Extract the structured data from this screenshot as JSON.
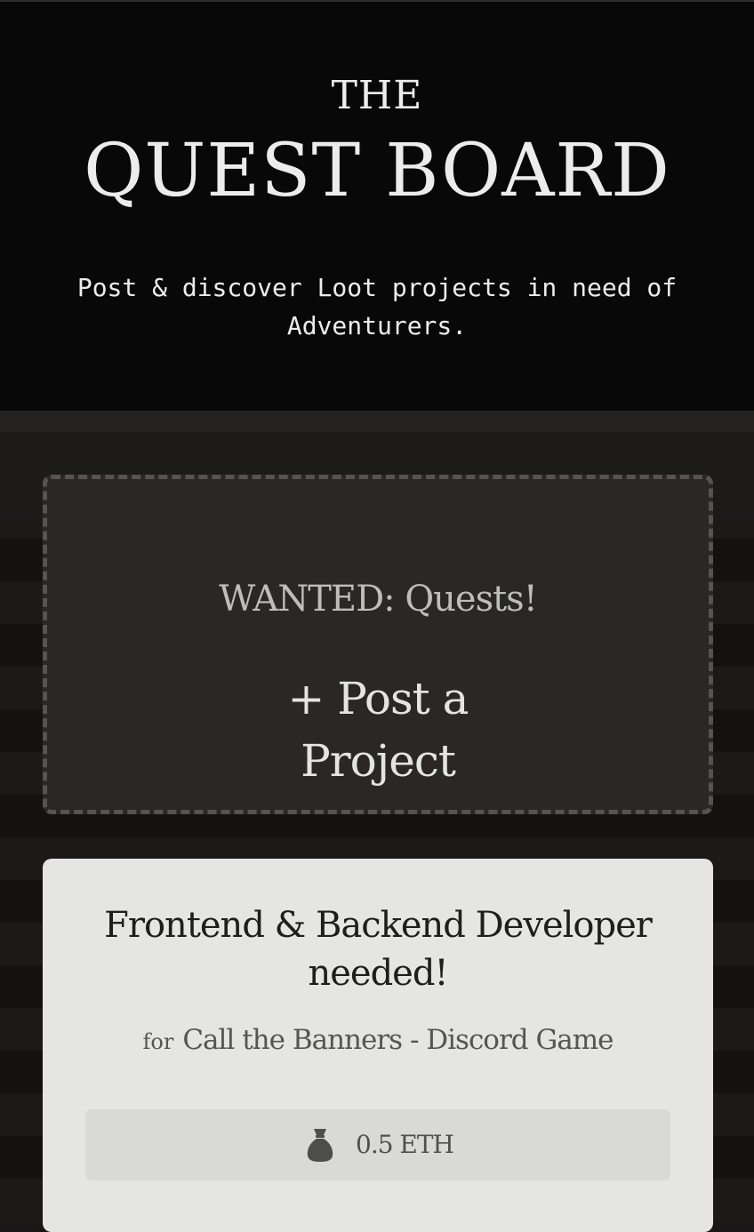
{
  "header": {
    "title_small": "THE",
    "title_big": "QUEST BOARD",
    "subtitle": "Post & discover Loot projects in need of Adventurers."
  },
  "wanted_card": {
    "heading": "WANTED: Quests!",
    "post_button_label": "+ Post a Project"
  },
  "quests": [
    {
      "title": "Frontend & Backend Developer needed!",
      "for_label": "for",
      "project": "Call the Banners - Discord Game",
      "reward_icon": "money-bag-icon",
      "reward": "0.5 ETH"
    }
  ],
  "colors": {
    "header_bg": "#080808",
    "board_bg": "#1a1816",
    "wanted_card_bg": "#2b2727",
    "wanted_card_border": "#575351",
    "quest_card_bg": "#e5e5e4",
    "reward_box_bg": "#d9d9d8"
  }
}
